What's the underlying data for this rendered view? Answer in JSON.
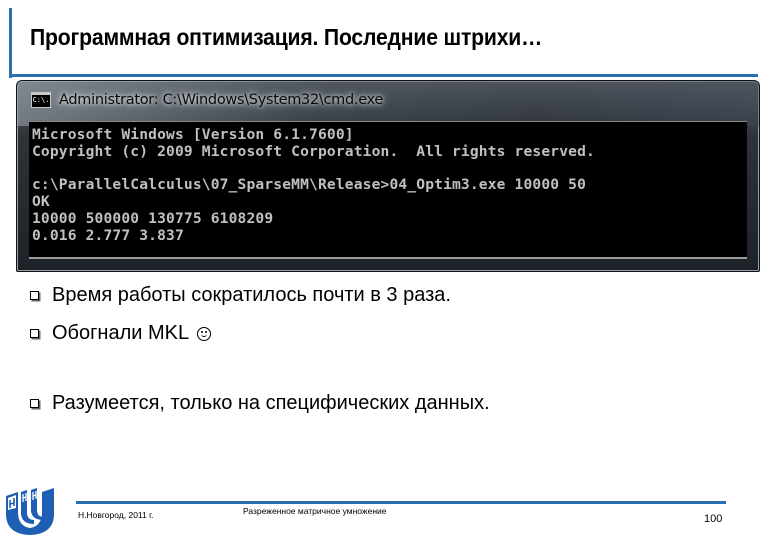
{
  "slide": {
    "title": "Программная оптимизация. Последние штрихи…",
    "accent_color": "#2a6fb0"
  },
  "cmd_window": {
    "icon": "cmd-icon",
    "icon_text": "C:\\.",
    "title": "Administrator: C:\\Windows\\System32\\cmd.exe",
    "lines": [
      "Microsoft Windows [Version 6.1.7600]",
      "Copyright (c) 2009 Microsoft Corporation.  All rights reserved.",
      "",
      "c:\\ParallelCalculus\\07_SparseMM\\Release>04_Optim3.exe 10000 50",
      "OK",
      "10000 500000 130775 6108209",
      "0.016 2.777 3.837"
    ]
  },
  "bullets": [
    {
      "icon": "checkbox-bullet-icon",
      "text": "Время работы сократилось почти в 3 раза."
    },
    {
      "icon": "checkbox-bullet-icon",
      "text": "Обогнали MKL",
      "suffix_icon": "smiley-icon"
    },
    {
      "icon": "checkbox-bullet-icon",
      "text": "Разумеется, только на специфических данных."
    }
  ],
  "footer": {
    "logo": "unn-logo-icon",
    "city_year": "Н.Новгород, 2011 г.",
    "topic": "Разреженное матричное умножение",
    "page_number": "100"
  }
}
